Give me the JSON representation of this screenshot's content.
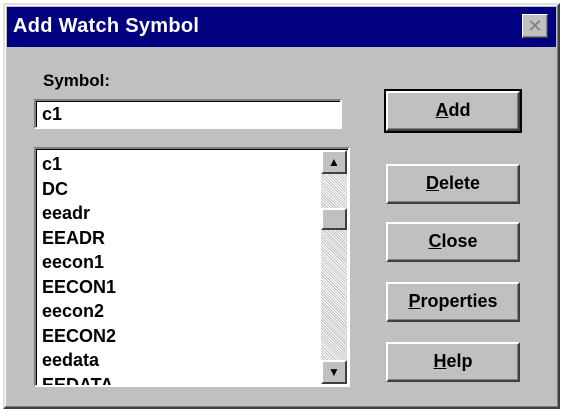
{
  "window": {
    "title": "Add Watch Symbol"
  },
  "form": {
    "symbol_label": "Symbol:",
    "symbol_value": "c1"
  },
  "symbol_list": {
    "items": [
      "c1",
      "DC",
      "eeadr",
      "EEADR",
      "eecon1",
      "EECON1",
      "eecon2",
      "EECON2",
      "eedata",
      "EEDATA"
    ]
  },
  "buttons": {
    "add": {
      "mnemonic": "A",
      "rest": "dd"
    },
    "delete": {
      "mnemonic": "D",
      "rest": "elete"
    },
    "close": {
      "mnemonic": "C",
      "rest": "lose"
    },
    "properties": {
      "mnemonic": "P",
      "rest": "roperties"
    },
    "help": {
      "mnemonic": "H",
      "rest": "elp"
    }
  },
  "icons": {
    "close": "close-icon",
    "scroll_up": "arrow-up-icon",
    "scroll_down": "arrow-down-icon"
  },
  "colors": {
    "titlebar": "#000080",
    "face": "#c0c0c0"
  }
}
